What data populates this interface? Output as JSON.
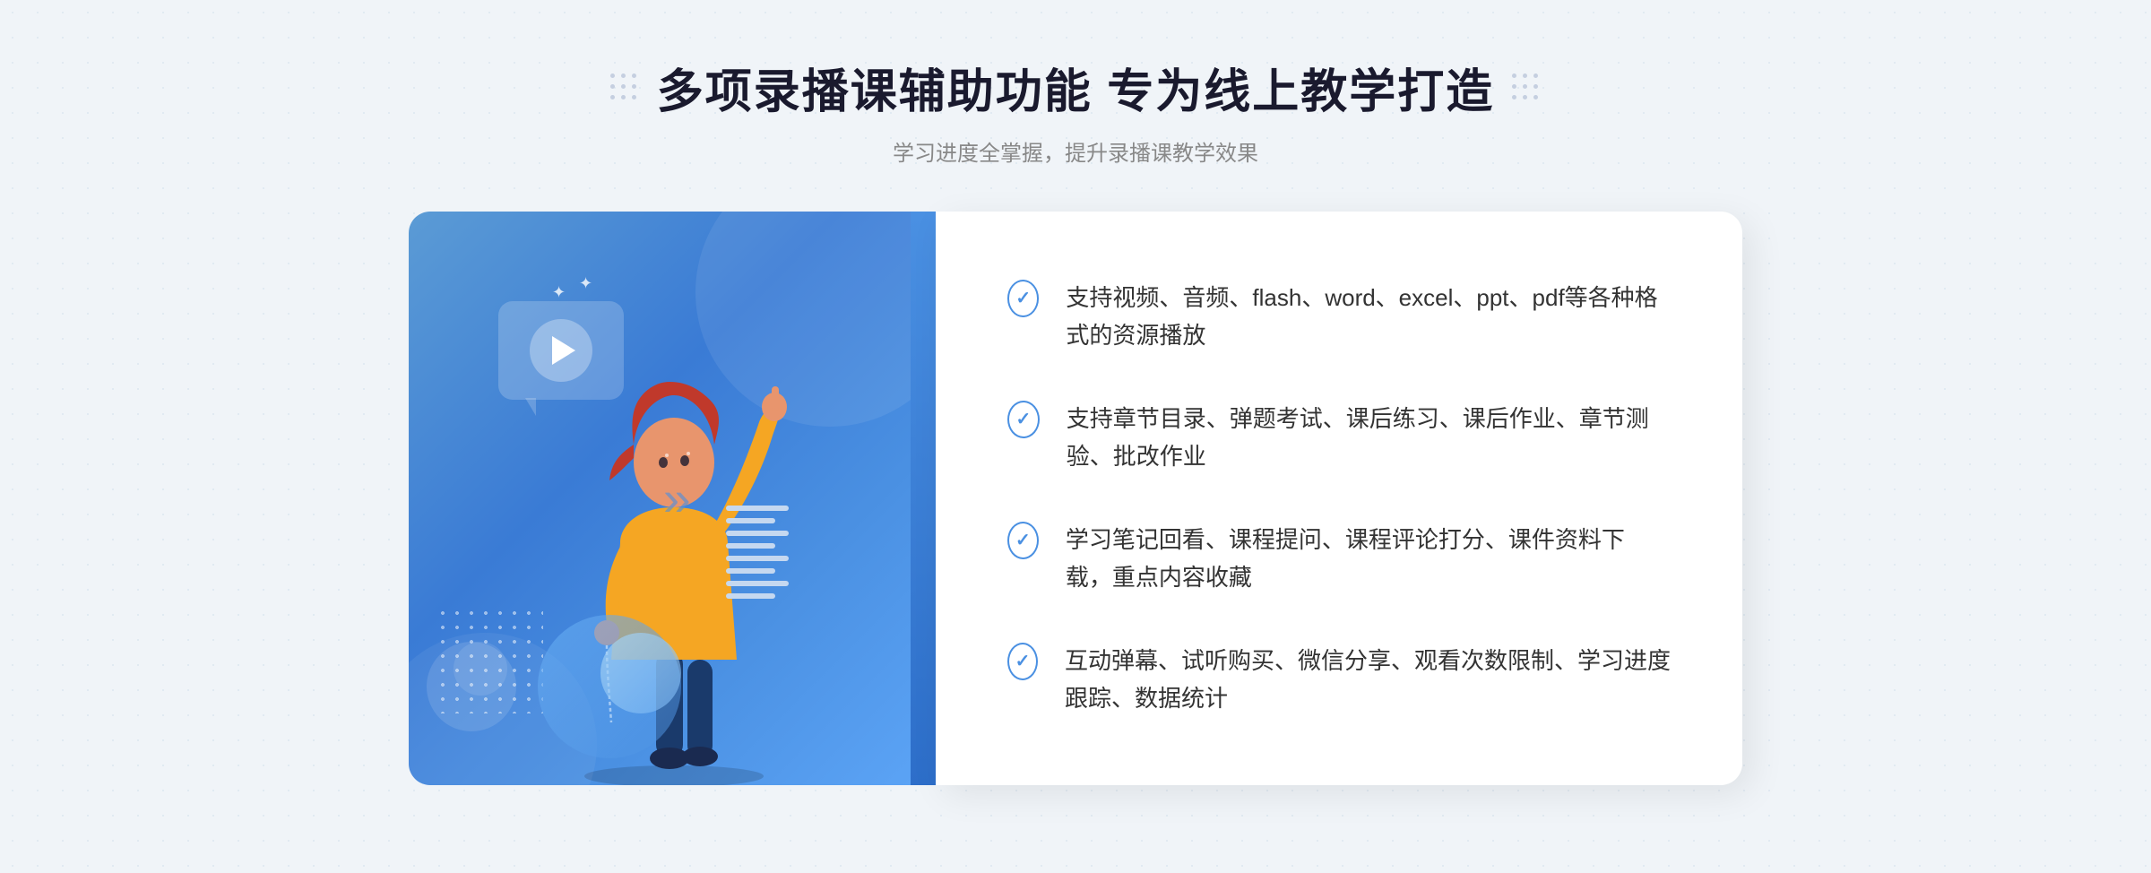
{
  "header": {
    "title": "多项录播课辅助功能 专为线上教学打造",
    "subtitle": "学习进度全掌握，提升录播课教学效果"
  },
  "features": [
    {
      "id": "feature-1",
      "text": "支持视频、音频、flash、word、excel、ppt、pdf等各种格式的资源播放"
    },
    {
      "id": "feature-2",
      "text": "支持章节目录、弹题考试、课后练习、课后作业、章节测验、批改作业"
    },
    {
      "id": "feature-3",
      "text": "学习笔记回看、课程提问、课程评论打分、课件资料下载，重点内容收藏"
    },
    {
      "id": "feature-4",
      "text": "互动弹幕、试听购买、微信分享、观看次数限制、学习进度跟踪、数据统计"
    }
  ],
  "decorations": {
    "dots_label": "·:·",
    "chevron_left": "《"
  },
  "colors": {
    "primary": "#4a90e2",
    "primary_dark": "#2d6ec9",
    "text_dark": "#1a1a2e",
    "text_gray": "#888888",
    "text_feature": "#333333"
  }
}
